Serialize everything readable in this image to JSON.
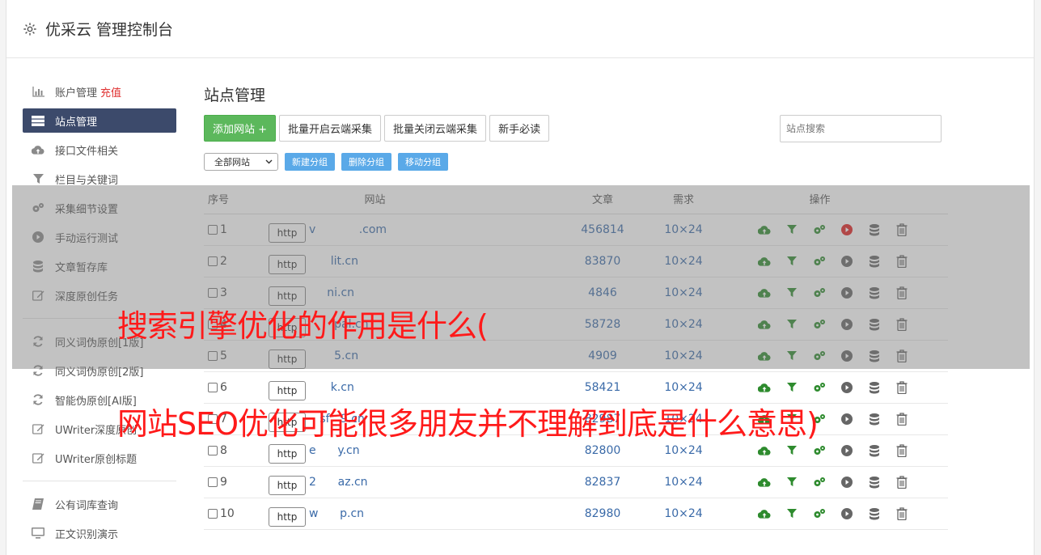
{
  "app_title": "优采云 管理控制台",
  "sidebar": {
    "items": [
      {
        "label": "账户管理",
        "extra": "充值",
        "icon": "bar-chart-icon"
      },
      {
        "label": "站点管理",
        "icon": "server-icon",
        "active": true
      },
      {
        "label": "接口文件相关",
        "icon": "cloud-upload-icon"
      },
      {
        "label": "栏目与关键词",
        "icon": "filter-icon"
      },
      {
        "label": "采集细节设置",
        "icon": "gears-icon"
      },
      {
        "label": "手动运行测试",
        "icon": "play-circle-icon"
      },
      {
        "label": "文章暂存库",
        "icon": "database-icon"
      },
      {
        "label": "深度原创任务",
        "icon": "edit-icon"
      }
    ],
    "items2": [
      {
        "label": "同义词伪原创[1版]",
        "icon": "refresh-icon"
      },
      {
        "label": "同义词伪原创[2版]",
        "icon": "refresh-icon"
      },
      {
        "label": "智能伪原创[AI版]",
        "icon": "refresh-icon"
      },
      {
        "label": "UWriter深度原创",
        "icon": "edit-icon"
      },
      {
        "label": "UWriter原创标题",
        "icon": "edit-icon"
      }
    ],
    "items3": [
      {
        "label": "公有词库查询",
        "icon": "book-icon"
      },
      {
        "label": "正文识别演示",
        "icon": "monitor-icon"
      }
    ]
  },
  "main": {
    "title": "站点管理",
    "add_site": "添加网站 +",
    "batch_open": "批量开启云端采集",
    "batch_close": "批量关闭云端采集",
    "beginner": "新手必读",
    "search_placeholder": "站点搜索",
    "filter_select": "全部网站",
    "new_group": "新建分组",
    "delete_group": "删除分组",
    "move_group": "移动分组"
  },
  "table": {
    "headers": {
      "no": "序号",
      "site": "网站",
      "articles": "文章",
      "demand": "需求",
      "ops": "操作"
    },
    "http_label": "http",
    "rows": [
      {
        "no": "1",
        "domain": "v            .com",
        "articles": "456814",
        "demand": "10×24",
        "running": true
      },
      {
        "no": "2",
        "domain": "      lit.cn",
        "articles": "83870",
        "demand": "10×24",
        "running": false
      },
      {
        "no": "3",
        "domain": "     ni.cn",
        "articles": "4846",
        "demand": "10×24",
        "running": false
      },
      {
        "no": "4",
        "domain": "       pal.cn",
        "articles": "58728",
        "demand": "10×24",
        "running": false
      },
      {
        "no": "5",
        "domain": "       5.cn",
        "articles": "4909",
        "demand": "10×24",
        "running": false
      },
      {
        "no": "6",
        "domain": "      k.cn",
        "articles": "58421",
        "demand": "10×24",
        "running": false
      },
      {
        "no": "7",
        "domain": "   sf   9.cn",
        "articles": "82987",
        "demand": "10×24",
        "running": false
      },
      {
        "no": "8",
        "domain": "e      y.cn",
        "articles": "82800",
        "demand": "10×24",
        "running": false
      },
      {
        "no": "9",
        "domain": "2      az.cn",
        "articles": "82837",
        "demand": "10×24",
        "running": false
      },
      {
        "no": "10",
        "domain": "w      p.cn",
        "articles": "82980",
        "demand": "10×24",
        "running": false
      }
    ]
  },
  "watermark": {
    "line1": "搜索引擎优化的作用是什么(",
    "line2": "网站SEO优化可能很多朋友并不理解到底是什么意思)"
  },
  "colors": {
    "sidebar_active": "#3c4a6b",
    "green": "#5cb85c",
    "blue_btn": "#5aa9e8",
    "link": "#3a6aa8",
    "icon_green": "#2e8b2e",
    "play_red": "#e02020"
  }
}
